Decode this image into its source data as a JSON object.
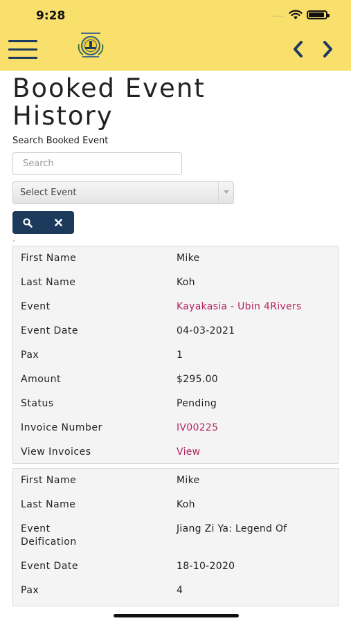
{
  "status_bar": {
    "time": "9:28",
    "signal_dots": "....",
    "icons": [
      "wifi-icon",
      "battery-icon"
    ]
  },
  "app_bar": {
    "menu_icon": "hamburger-menu-icon",
    "logo": "organization-crest-logo",
    "prev_icon": "chevron-left-icon",
    "next_icon": "chevron-right-icon"
  },
  "page": {
    "title": "Booked Event History",
    "search_caption": "Search Booked Event",
    "search_placeholder": "Search",
    "select_label": "Select Event",
    "search_button_icon": "search-icon",
    "clear_button_icon": "close-icon"
  },
  "colors": {
    "header_bg": "#f9df6c",
    "nav_dark": "#1b3a5c",
    "link": "#b3245d",
    "card_bg": "#f4f4f4"
  },
  "bookings": [
    {
      "rows": [
        {
          "label": "First Name",
          "value": "Mike"
        },
        {
          "label": "Last Name",
          "value": "Koh"
        },
        {
          "label": "Event",
          "value": "Kayakasia - Ubin 4Rivers",
          "link": true
        },
        {
          "label": "Event Date",
          "value": "04-03-2021"
        },
        {
          "label": "Pax",
          "value": "1"
        },
        {
          "label": "Amount",
          "value": "$295.00"
        },
        {
          "label": "Status",
          "value": "Pending"
        },
        {
          "label": "Invoice Number",
          "value": "IV00225",
          "link": true
        },
        {
          "label": "View Invoices",
          "value": "View",
          "link": true
        }
      ]
    },
    {
      "rows": [
        {
          "label": "First Name",
          "value": "Mike"
        },
        {
          "label": "Last Name",
          "value": "Koh"
        },
        {
          "label": "Event",
          "value": "Jiang Zi Ya: Legend Of",
          "value_continued": "Deification"
        },
        {
          "label": "Event Date",
          "value": "18-10-2020"
        },
        {
          "label": "Pax",
          "value": "4"
        }
      ]
    }
  ]
}
